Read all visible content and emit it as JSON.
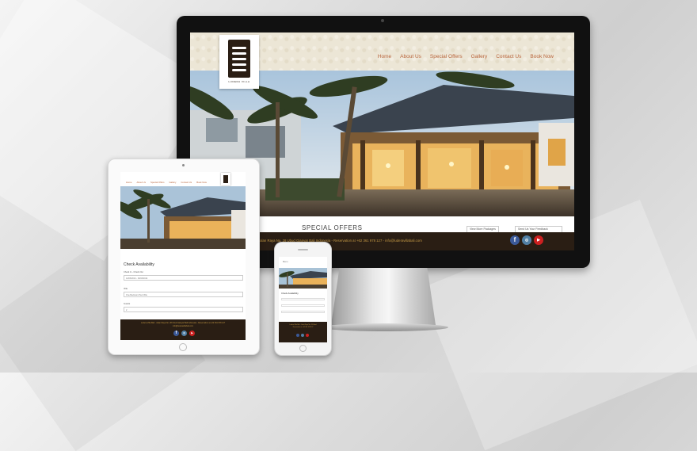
{
  "desktop": {
    "logo_text": "LUDERA VILLA",
    "nav": [
      "Home",
      "About Us",
      "Special Offers",
      "Gallery",
      "Contact Us",
      "Book Now"
    ],
    "offers_title": "SPECIAL OFFERS",
    "btn_view_more": "View More Packages",
    "btn_send": "Send Us Your Feedback",
    "footer_text": "Jalan Raya No. 28 Ubud Gianyar Bali Indonesia - Reservation at +62 361 978 127 - info@luderavillabali.com",
    "social": [
      "f",
      "ig",
      "yt"
    ]
  },
  "tablet": {
    "nav": [
      "Home",
      "About Us",
      "Special Offers",
      "Gallery",
      "Contact Us",
      "Book Now"
    ],
    "check_title": "Check Availability",
    "label_dates": "Check In - Check Out",
    "field_dates": "14/03/2014 - 16/03/2014",
    "label_villa": "Villa",
    "field_villa": "One Bedroom Pool Villa",
    "label_guests": "Guests",
    "field_guests": "2",
    "footer_line1": "Ludera Villa Bali - Jalan Raya No. 28 Ubud Gianyar Bali Indonesia - Reservation at +62 361 978 127",
    "footer_line2": "info@luderavillabali.com"
  },
  "phone": {
    "menu": "Menu",
    "check_title": "Check Availability",
    "footer_line1": "Ludera Villa Bali - Jalan Raya No. 28 Ubud",
    "footer_line2": "Reservation at +62 361 978 127"
  },
  "colors": {
    "accent": "#b9653c",
    "footer_bg": "#2a1e14",
    "footer_text": "#c59a45",
    "facebook": "#3b5998",
    "instagram": "#517fa4",
    "youtube": "#cc2020"
  }
}
